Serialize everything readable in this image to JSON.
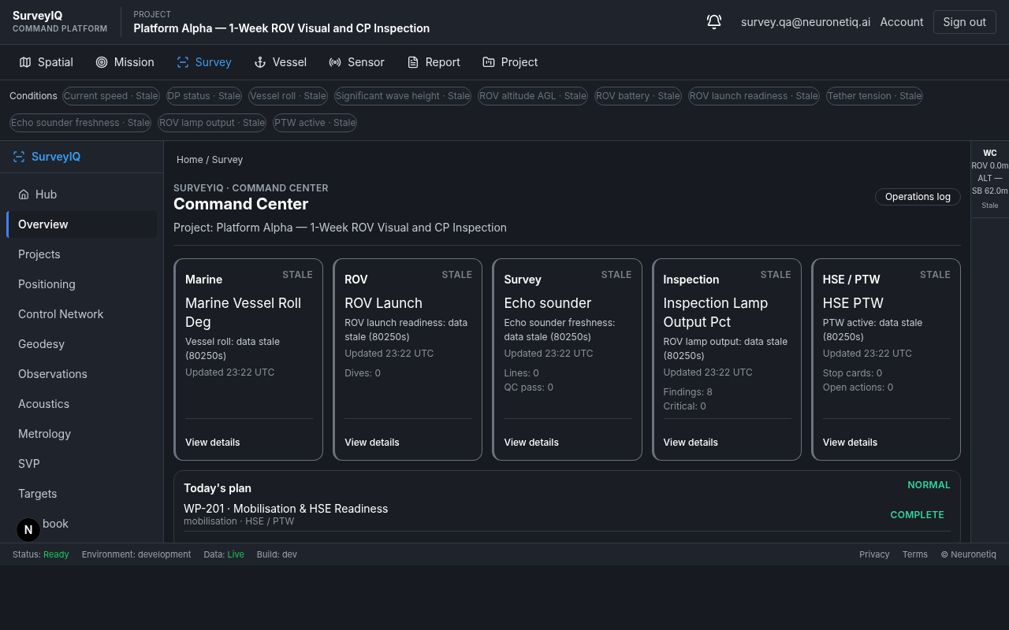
{
  "brand": {
    "name": "SurveyIQ",
    "subtitle": "COMMAND PLATFORM"
  },
  "project": {
    "label": "PROJECT",
    "title": "Platform Alpha — 1-Week ROV Visual and CP Inspection"
  },
  "user": {
    "email": "survey.qa@neuronetiq.ai",
    "account": "Account",
    "sign_out": "Sign out"
  },
  "tabs": [
    {
      "label": "Spatial",
      "selected": false
    },
    {
      "label": "Mission",
      "selected": false
    },
    {
      "label": "Survey",
      "selected": true
    },
    {
      "label": "Vessel",
      "selected": false
    },
    {
      "label": "Sensor",
      "selected": false
    },
    {
      "label": "Report",
      "selected": false
    },
    {
      "label": "Project",
      "selected": false
    }
  ],
  "conditions": {
    "label": "Conditions",
    "chips": [
      "Current speed · Stale",
      "DP status · Stale",
      "Vessel roll · Stale",
      "Significant wave height · Stale",
      "ROV altitude AGL · Stale",
      "ROV battery · Stale",
      "ROV launch readiness · Stale",
      "Tether tension · Stale",
      "Echo sounder freshness · Stale",
      "ROV lamp output · Stale",
      "PTW active · Stale"
    ]
  },
  "sidebar": {
    "title": "SurveyIQ",
    "items": [
      {
        "label": "Hub",
        "kind": "home",
        "selected": false
      },
      {
        "label": "Overview",
        "kind": "link",
        "selected": true
      },
      {
        "label": "Projects",
        "kind": "link",
        "selected": false
      },
      {
        "label": "Positioning",
        "kind": "link",
        "selected": false
      },
      {
        "label": "Control Network",
        "kind": "link",
        "selected": false
      },
      {
        "label": "Geodesy",
        "kind": "link",
        "selected": false
      },
      {
        "label": "Observations",
        "kind": "link",
        "selected": false
      },
      {
        "label": "Acoustics",
        "kind": "link",
        "selected": false
      },
      {
        "label": "Metrology",
        "kind": "link",
        "selected": false
      },
      {
        "label": "SVP",
        "kind": "link",
        "selected": false
      },
      {
        "label": "Targets",
        "kind": "link",
        "selected": false
      },
      {
        "label": "book",
        "kind": "link",
        "selected": false
      }
    ]
  },
  "breadcrumb": "Home / Survey",
  "page": {
    "eyebrow": "SURVEYIQ · COMMAND CENTER",
    "title": "Command Center",
    "subtitle": "Project: Platform Alpha — 1-Week ROV Visual and CP Inspection",
    "action": "Operations log"
  },
  "cards": [
    {
      "category": "Marine",
      "status": "STALE",
      "title": "Marine Vessel Roll Deg",
      "message": "Vessel roll: data stale (80250s)",
      "updated": "Updated 23:22 UTC",
      "link": "View details"
    },
    {
      "category": "ROV",
      "status": "STALE",
      "title": "ROV Launch",
      "message": "ROV launch readiness: data stale (80250s)",
      "updated": "Updated 23:22 UTC",
      "stats": [
        "Dives: 0"
      ],
      "link": "View details"
    },
    {
      "category": "Survey",
      "status": "STALE",
      "title": "Echo sounder",
      "message": "Echo sounder freshness: data stale (80250s)",
      "updated": "Updated 23:22 UTC",
      "stats": [
        "Lines: 0",
        "QC pass: 0"
      ],
      "link": "View details"
    },
    {
      "category": "Inspection",
      "status": "STALE",
      "title": "Inspection Lamp Output Pct",
      "message": "ROV lamp output: data stale (80250s)",
      "updated": "Updated 23:22 UTC",
      "stats": [
        "Findings: 8",
        "Critical: 0"
      ],
      "link": "View details"
    },
    {
      "category": "HSE / PTW",
      "status": "STALE",
      "title": "HSE PTW",
      "message": "PTW active: data stale (80250s)",
      "updated": "Updated 23:22 UTC",
      "stats": [
        "Stop cards: 0",
        "Open actions: 0"
      ],
      "link": "View details"
    }
  ],
  "plan": {
    "title": "Today's plan",
    "status": "NORMAL",
    "items": [
      {
        "title": "WP-201 · Mobilisation & HSE Readiness",
        "meta": "mobilisation · HSE / PTW",
        "status": "COMPLETE"
      }
    ]
  },
  "rail": {
    "title": "WC",
    "lines": [
      "ROV 0.0m",
      "ALT —",
      "SB 62.0m"
    ],
    "status": "Stale"
  },
  "badge": "N",
  "status_bar": {
    "items": [
      {
        "label": "Status: ",
        "value": "Ready"
      },
      {
        "label": "Environment: development"
      },
      {
        "label": "Data: ",
        "value": "Live"
      },
      {
        "label": "Build: dev"
      }
    ],
    "links": [
      "Privacy",
      "Terms",
      "© Neuronetiq"
    ]
  }
}
